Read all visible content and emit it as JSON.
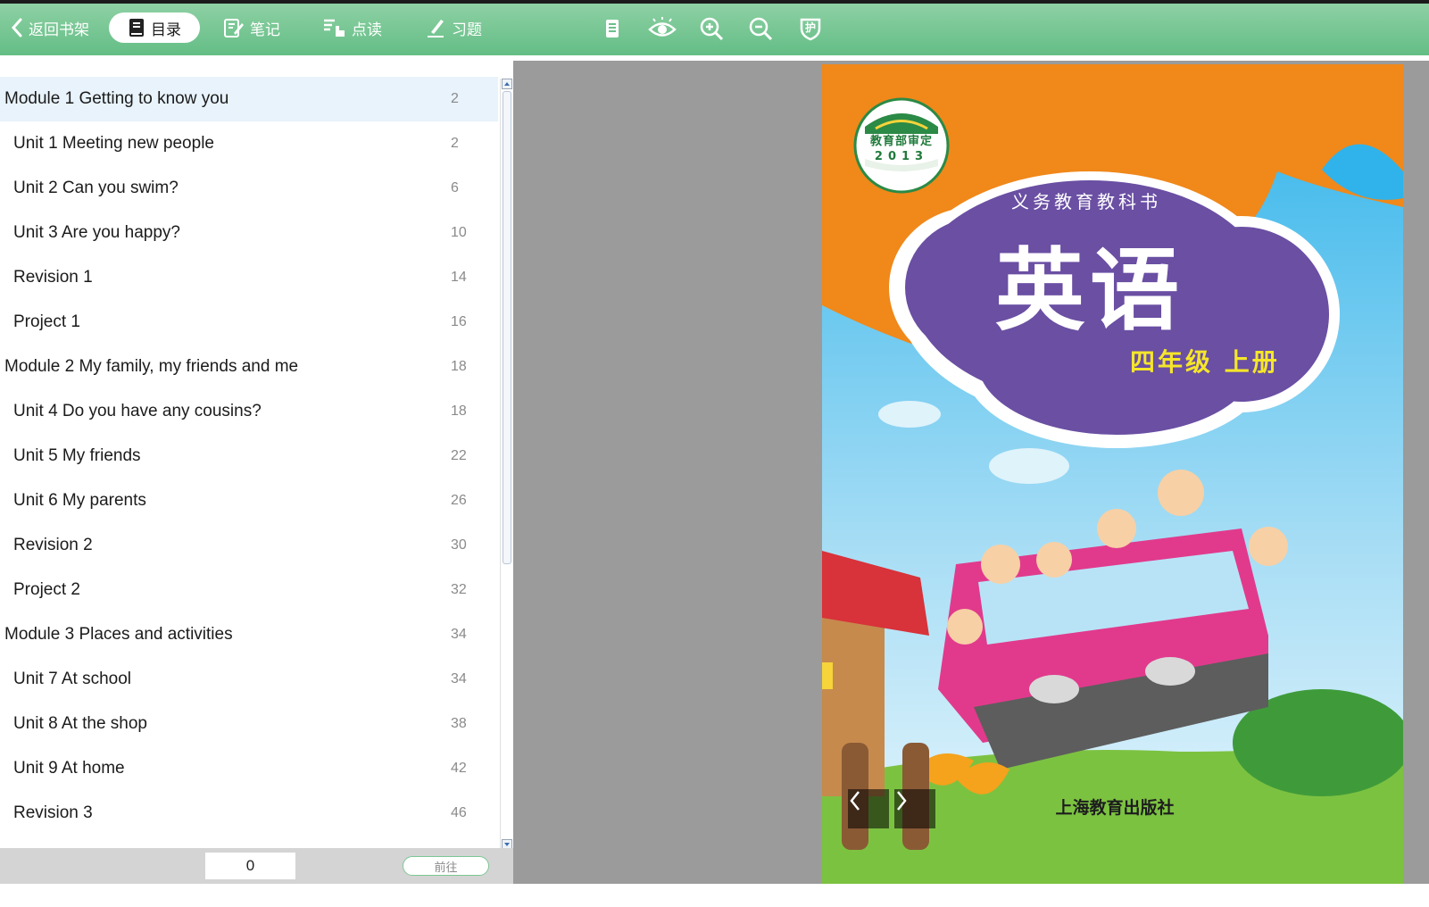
{
  "toolbar": {
    "back_label": "返回书架",
    "toc_label": "目录",
    "notes_label": "笔记",
    "read_label": "点读",
    "exercises_label": "习题",
    "colors": {
      "bar": "#6cc08c",
      "active_pill": "#ffffff"
    },
    "icons": [
      "notebook-icon",
      "eye-icon",
      "zoom-in-icon",
      "zoom-out-icon",
      "eye-protection-icon"
    ],
    "protect_label": "护"
  },
  "toc": {
    "items": [
      {
        "title": "Module 1 Getting to know you",
        "page": "2",
        "level": "module",
        "active": true
      },
      {
        "title": "Unit 1 Meeting new people",
        "page": "2",
        "level": "unit"
      },
      {
        "title": "Unit 2 Can you swim?",
        "page": "6",
        "level": "unit"
      },
      {
        "title": "Unit 3 Are you happy?",
        "page": "10",
        "level": "unit"
      },
      {
        "title": "Revision 1",
        "page": "14",
        "level": "unit"
      },
      {
        "title": "Project 1",
        "page": "16",
        "level": "unit"
      },
      {
        "title": "Module 2 My family, my friends and me",
        "page": "18",
        "level": "module"
      },
      {
        "title": "Unit 4 Do you have any cousins?",
        "page": "18",
        "level": "unit"
      },
      {
        "title": "Unit 5 My friends",
        "page": "22",
        "level": "unit"
      },
      {
        "title": "Unit 6 My parents",
        "page": "26",
        "level": "unit"
      },
      {
        "title": "Revision 2",
        "page": "30",
        "level": "unit"
      },
      {
        "title": "Project 2",
        "page": "32",
        "level": "unit"
      },
      {
        "title": "Module 3 Places and activities",
        "page": "34",
        "level": "module"
      },
      {
        "title": "Unit 7 At school",
        "page": "34",
        "level": "unit"
      },
      {
        "title": "Unit 8 At the shop",
        "page": "38",
        "level": "unit"
      },
      {
        "title": "Unit 9 At home",
        "page": "42",
        "level": "unit"
      },
      {
        "title": "Revision 3",
        "page": "46",
        "level": "unit"
      }
    ]
  },
  "footer": {
    "page_input_value": "0",
    "go_label": "前往"
  },
  "cover": {
    "seal_text": "教育部审定",
    "seal_year": "2013",
    "series": "义务教育教科书",
    "title": "英语",
    "grade": "四年级 上册",
    "publisher": "上海教育出版社",
    "colors": {
      "orange": "#f0881a",
      "sky": "#5ec3ef",
      "cloud": "#6a4fa3",
      "grade_text": "#f5e62a",
      "grass": "#7cc241"
    }
  }
}
